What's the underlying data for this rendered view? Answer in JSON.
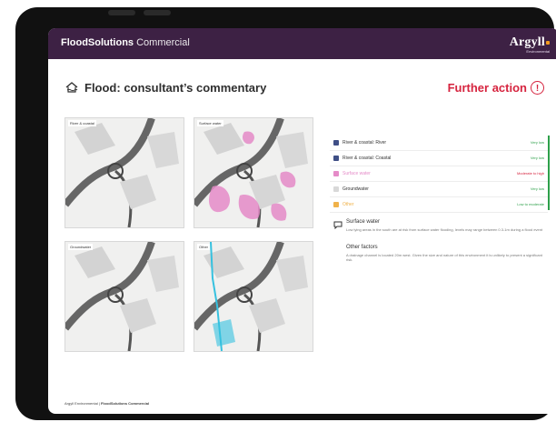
{
  "app": {
    "brand_strong": "FloodSolutions",
    "brand_light": "Commercial",
    "logo_word": "Argyll",
    "logo_sub": "Environmental"
  },
  "page": {
    "title": "Flood: consultant’s commentary",
    "action_label": "Further action",
    "action_icon": "!"
  },
  "maps": [
    {
      "label": "River & coastal"
    },
    {
      "label": "Surface water"
    },
    {
      "label": "Groundwater"
    },
    {
      "label": "Other"
    }
  ],
  "risks": [
    {
      "label": "River & coastal: River",
      "rating": "Very low",
      "swatch": "#3f4f86",
      "rating_color": "#2ea04a"
    },
    {
      "label": "River & coastal: Coastal",
      "rating": "Very low",
      "swatch": "#3f4f86",
      "rating_color": "#2ea04a"
    },
    {
      "label": "Surface water",
      "rating": "Moderate to high",
      "swatch": "#e58bc8",
      "rating_color": "#d6243f"
    },
    {
      "label": "Groundwater",
      "rating": "Very low",
      "swatch": "#d8d8d8",
      "rating_color": "#2ea04a"
    },
    {
      "label": "Other",
      "rating": "Low to moderate",
      "swatch": "#f0b24a",
      "rating_color": "#2ea04a"
    }
  ],
  "commentary": {
    "title": "Surface water",
    "body": "Low lying areas in the south are at risk from surface water flooding, levels may range between 0.3-1m during a flood event",
    "title2": "Other factors",
    "body2": "A drainage channel is located 20m west. Given the size and nature of this environment it is unlikely to present a significant risk."
  },
  "footer": {
    "text": "Argyll Environmental |",
    "strong": "FloodSolutions Commercial"
  },
  "colors": {
    "header_bg": "#3d2144",
    "alert_red": "#d6243f",
    "accent_green": "#2ea04a",
    "surface_pink": "#e58bc8",
    "other_cyan": "#36c1df"
  },
  "icons": {
    "header_left": "house-flood-icon",
    "action": "warning-circle-icon",
    "commentary": "speech-bubble-icon"
  }
}
